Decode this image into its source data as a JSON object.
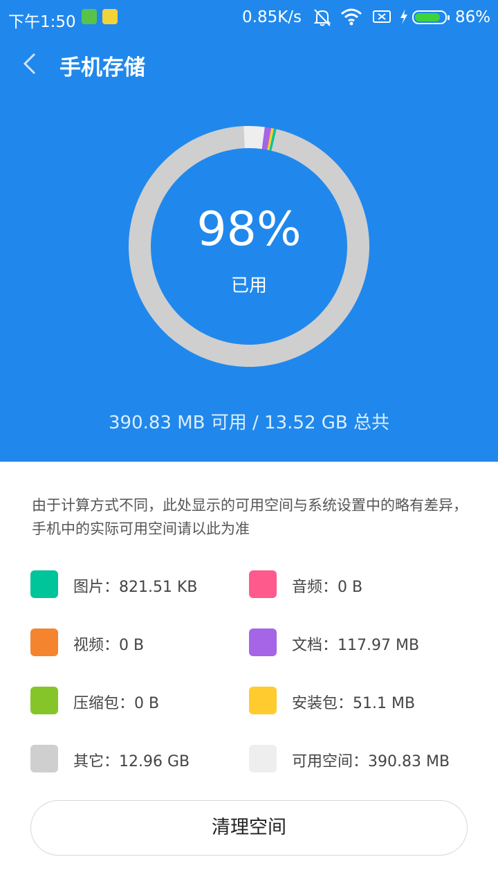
{
  "status_bar": {
    "time": "下午1:50",
    "net_speed": "0.85K/s",
    "battery_percent": "86%",
    "battery_level": 0.86,
    "icons": [
      "app-icon-1",
      "app-icon-2",
      "mute-bell-icon",
      "wifi-icon",
      "sim-off-icon",
      "charging-icon",
      "battery-icon"
    ]
  },
  "header": {
    "title": "手机存储",
    "back_icon": "chevron-left-icon"
  },
  "usage": {
    "percent": "98%",
    "label": "已用",
    "summary": "390.83 MB 可用 / 13.52 GB 总共"
  },
  "notice": "由于计算方式不同，此处显示的可用空间与系统设置中的略有差异，手机中的实际可用空间请以此为准",
  "legend": [
    {
      "label": "图片：821.51 KB",
      "color": "#00c49a"
    },
    {
      "label": "音频：0 B",
      "color": "#ff5a8c"
    },
    {
      "label": "视频：0 B",
      "color": "#f5842f"
    },
    {
      "label": "文档：117.97 MB",
      "color": "#a664e6"
    },
    {
      "label": "压缩包：0 B",
      "color": "#86c52a"
    },
    {
      "label": "安装包：51.1 MB",
      "color": "#ffcb2e"
    },
    {
      "label": "其它：12.96 GB",
      "color": "#cfcfcf"
    },
    {
      "label": "可用空间：390.83 MB",
      "color": "#eeeeee"
    }
  ],
  "chart_data": {
    "type": "pie",
    "style": "donut",
    "unit": "MB",
    "slices": [
      {
        "name": "图片",
        "value": 0.8,
        "color": "#00c49a"
      },
      {
        "name": "音频",
        "value": 0,
        "color": "#ff5a8c"
      },
      {
        "name": "视频",
        "value": 0,
        "color": "#f5842f"
      },
      {
        "name": "文档",
        "value": 117.97,
        "color": "#a664e6"
      },
      {
        "name": "压缩包",
        "value": 0,
        "color": "#86c52a"
      },
      {
        "name": "安装包",
        "value": 51.1,
        "color": "#ffcb2e"
      },
      {
        "name": "其它",
        "value": 13271,
        "color": "#cfcfcf"
      },
      {
        "name": "可用空间",
        "value": 390.83,
        "color": "#eeeeee"
      }
    ]
  },
  "clean_button": "清理空间"
}
